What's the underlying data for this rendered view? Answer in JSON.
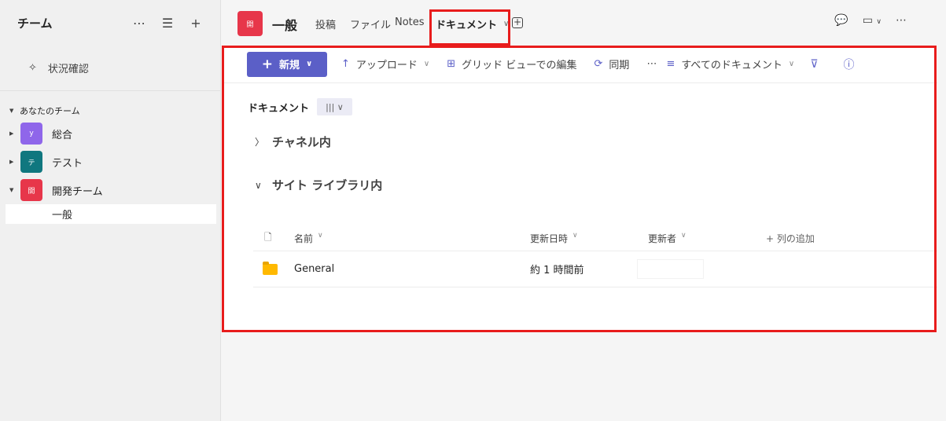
{
  "sidebar": {
    "title": "チーム",
    "activity_label": "状況確認",
    "group_label": "あなたのチーム",
    "teams": [
      {
        "name": "総合",
        "avatar_text": "y",
        "color": "#8f66ea"
      },
      {
        "name": "テスト",
        "avatar_text": "テ",
        "color": "#10777f"
      },
      {
        "name": "開発チーム",
        "avatar_text": "開",
        "color": "#e7364a"
      }
    ],
    "active_channel": "一般"
  },
  "header": {
    "team_avatar_text": "開",
    "channel_title": "一般",
    "tabs": [
      "投稿",
      "ファイル",
      "Notes"
    ],
    "active_tab": "ドキュメント"
  },
  "toolbar": {
    "new_label": "新規",
    "upload_label": "アップロード",
    "grid_edit_label": "グリッド ビューでの編集",
    "sync_label": "同期",
    "view_label": "すべてのドキュメント"
  },
  "library": {
    "breadcrumb": "ドキュメント",
    "section_channel": "チャネル内",
    "section_site": "サイト ライブラリ内",
    "columns": {
      "name": "名前",
      "modified": "更新日時",
      "modified_by": "更新者",
      "add_column": "+ 列の追加"
    },
    "rows": [
      {
        "name": "General",
        "modified": "約 1 時間前",
        "modified_by": ""
      }
    ]
  },
  "colors": {
    "accent": "#5b5fc7",
    "highlight_box": "#e81c1c",
    "team_red": "#e7364a"
  }
}
